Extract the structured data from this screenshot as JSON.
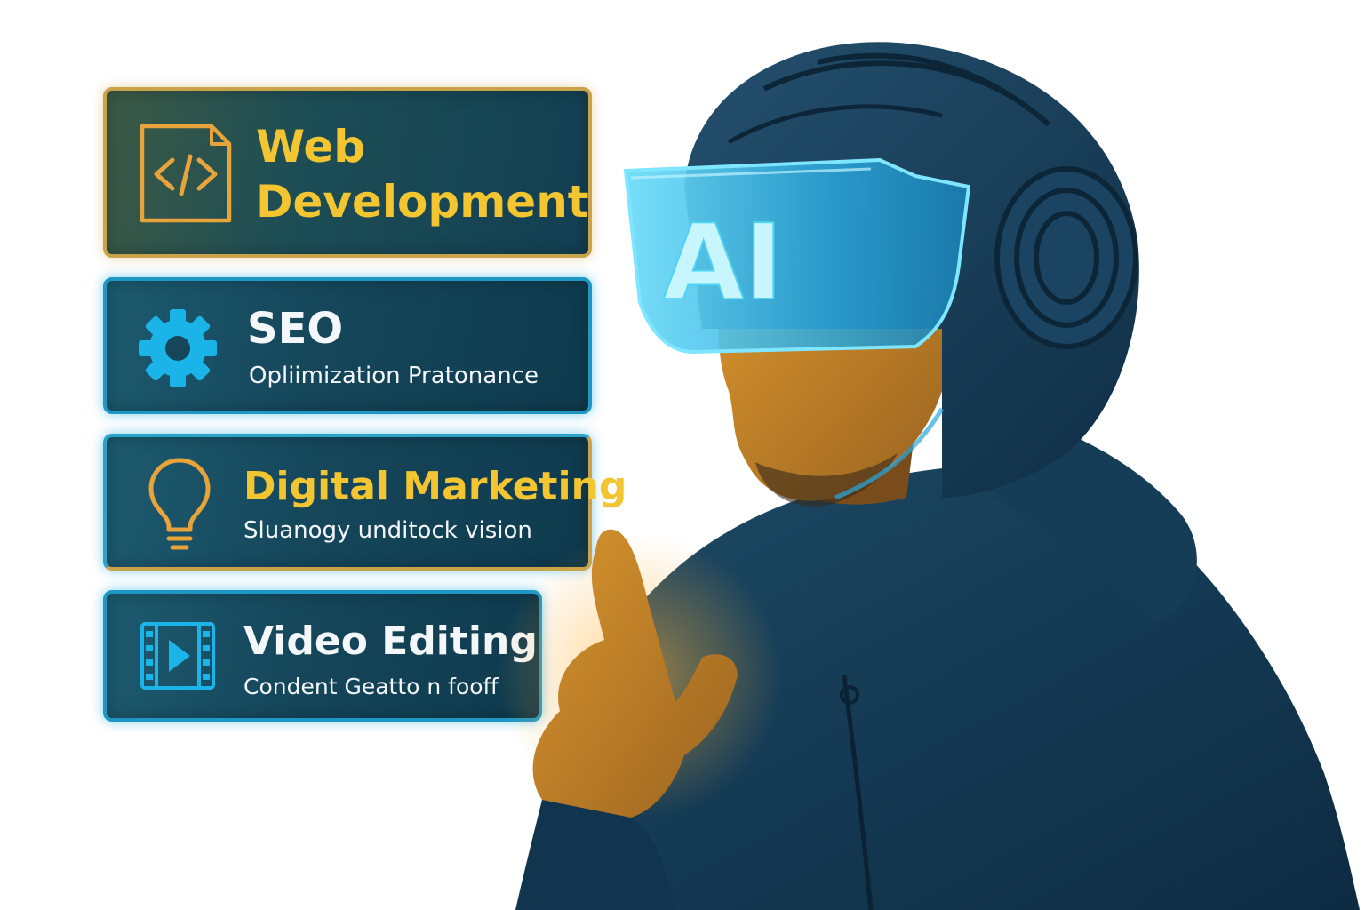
{
  "services": [
    {
      "title": "Web\nDevelopment",
      "subtitle": "",
      "icon": "code-icon",
      "accent": "#f2c531"
    },
    {
      "title": "SEO",
      "subtitle": "Opliimization Pratonance",
      "icon": "gear-icon",
      "accent": "#1ab4e8"
    },
    {
      "title": "Digital Marketing",
      "subtitle": "Sluanogy unditock vision",
      "icon": "lightbulb-icon",
      "accent": "#e8a33a"
    },
    {
      "title": "Video Editing",
      "subtitle": "Condent Geatto n fooff",
      "icon": "video-icon",
      "accent": "#1ab4e8"
    }
  ],
  "visor": {
    "label": "AI"
  },
  "colors": {
    "panel_border": "#1e97c4",
    "panel_gold_border": "#c9a24a",
    "title_gold": "#f2c531",
    "text_light": "#f4f7f9",
    "hoodie": "#12354f",
    "skin": "#c98a2a",
    "visor": "#3fc4ec"
  }
}
